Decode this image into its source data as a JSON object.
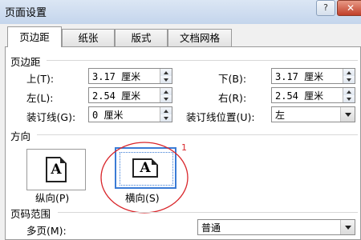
{
  "window": {
    "title": "页面设置",
    "help_glyph": "?",
    "close_glyph": "✕"
  },
  "tabs": [
    {
      "label": "页边距",
      "active": true
    },
    {
      "label": "纸张",
      "active": false
    },
    {
      "label": "版式",
      "active": false
    },
    {
      "label": "文档网格",
      "active": false
    }
  ],
  "margins": {
    "group_label": "页边距",
    "top": {
      "label": "上(T):",
      "value": "3.17 厘米"
    },
    "bottom": {
      "label": "下(B):",
      "value": "3.17 厘米"
    },
    "left": {
      "label": "左(L):",
      "value": "2.54 厘米"
    },
    "right": {
      "label": "右(R):",
      "value": "2.54 厘米"
    },
    "gutter": {
      "label": "装订线(G):",
      "value": "0 厘米"
    },
    "gutter_position": {
      "label": "装订线位置(U):",
      "value": "左"
    }
  },
  "orientation": {
    "group_label": "方向",
    "portrait": {
      "label": "纵向(P)",
      "glyph": "A",
      "selected": false
    },
    "landscape": {
      "label": "横向(S)",
      "glyph": "A",
      "selected": true
    },
    "annotation_number": "1"
  },
  "pages": {
    "group_label": "页码范围",
    "multiple_pages": {
      "label": "多页(M):",
      "value": "普通"
    }
  },
  "colors": {
    "annotation_red": "#d9262b",
    "selection_blue": "#3a7bd5"
  }
}
